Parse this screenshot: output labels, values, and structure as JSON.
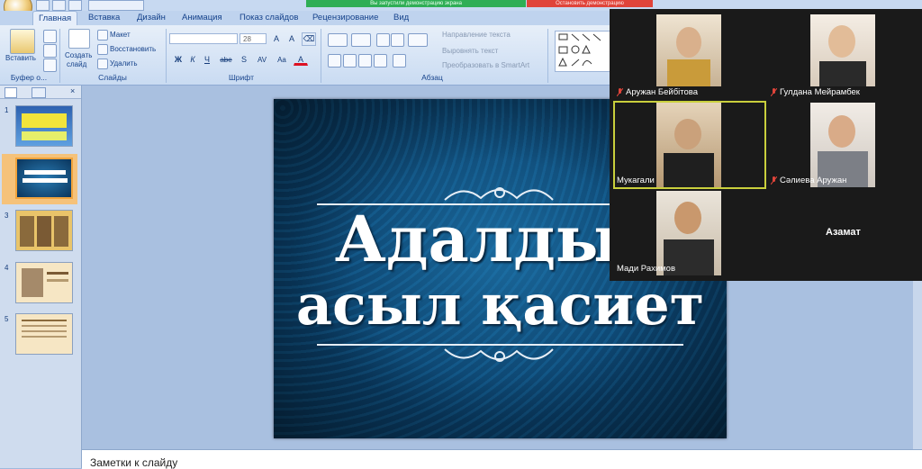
{
  "window": {
    "share_banner_text": "Вы запустили демонстрацию экрана",
    "stop_share_text": "Остановить демонстрацию"
  },
  "tabs": [
    {
      "label": "Главная",
      "active": true
    },
    {
      "label": "Вставка"
    },
    {
      "label": "Дизайн"
    },
    {
      "label": "Анимация"
    },
    {
      "label": "Показ слайдов"
    },
    {
      "label": "Рецензирование"
    },
    {
      "label": "Вид"
    }
  ],
  "ribbon": {
    "clipboard": {
      "paste": "Вставить",
      "group_label": "Буфер о..."
    },
    "slides": {
      "new_slide": "Создать",
      "new_slide_2": "слайд",
      "layout": "Макет",
      "reset": "Восстановить",
      "delete": "Удалить",
      "group_label": "Слайды"
    },
    "font": {
      "font_size": "28",
      "group_label": "Шрифт",
      "buttons": [
        "Ж",
        "К",
        "Ч",
        "abe",
        "S",
        "AV",
        "Aa",
        "A"
      ]
    },
    "paragraph": {
      "text_direction": "Направление текста",
      "align_text": "Выровнять текст",
      "smartart": "Преобразовать в SmartArt",
      "group_label": "Абзац"
    }
  },
  "slides_pane": {
    "numbers": [
      "1",
      "2",
      "3",
      "4",
      "5"
    ],
    "selected": 2
  },
  "slide": {
    "title_line1": "Адалдық",
    "title_line2": "асыл қасиет"
  },
  "notes": {
    "placeholder": "Заметки к слайду"
  },
  "video": {
    "participants": [
      {
        "name": "Аружан Бейбітова",
        "muted": true
      },
      {
        "name": "Гулдана Мейрамбек",
        "muted": true
      },
      {
        "name": "Мукагали",
        "muted": false,
        "active": true
      },
      {
        "name": "Сәлиева Аружан",
        "muted": true
      },
      {
        "name": "Мади Рахимов",
        "muted": false
      },
      {
        "name": "Азамат",
        "muted": false,
        "video_off": true
      }
    ]
  },
  "colors": {
    "ribbon_text": "#15428b",
    "slide_bg": "#0b3a62",
    "active_speaker": "#c9cf3c",
    "mute_icon": "#e0443a"
  }
}
